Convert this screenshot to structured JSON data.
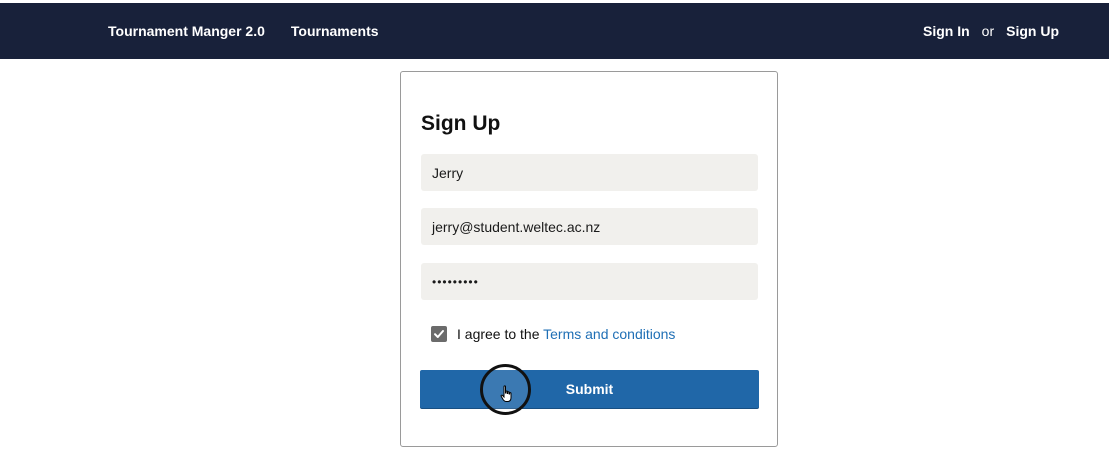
{
  "navbar": {
    "brand": "Tournament Manger 2.0",
    "tournaments": "Tournaments",
    "sign_in": "Sign In",
    "or": "or",
    "sign_up": "Sign Up"
  },
  "form": {
    "title": "Sign Up",
    "name_value": "Jerry",
    "email_value": "jerry@student.weltec.ac.nz",
    "password_value": "•••••••••",
    "agree_text": "I agree to the ",
    "terms_link": "Terms and conditions",
    "agree_checked": true,
    "submit_label": "Submit"
  },
  "colors": {
    "navbar_bg": "#18213a",
    "accent": "#2067a8",
    "link": "#1f6fb5",
    "field_bg": "#f1f0ed"
  },
  "icons": {
    "checkbox": "checkmark-icon",
    "cursor": "hand-pointer-icon"
  }
}
